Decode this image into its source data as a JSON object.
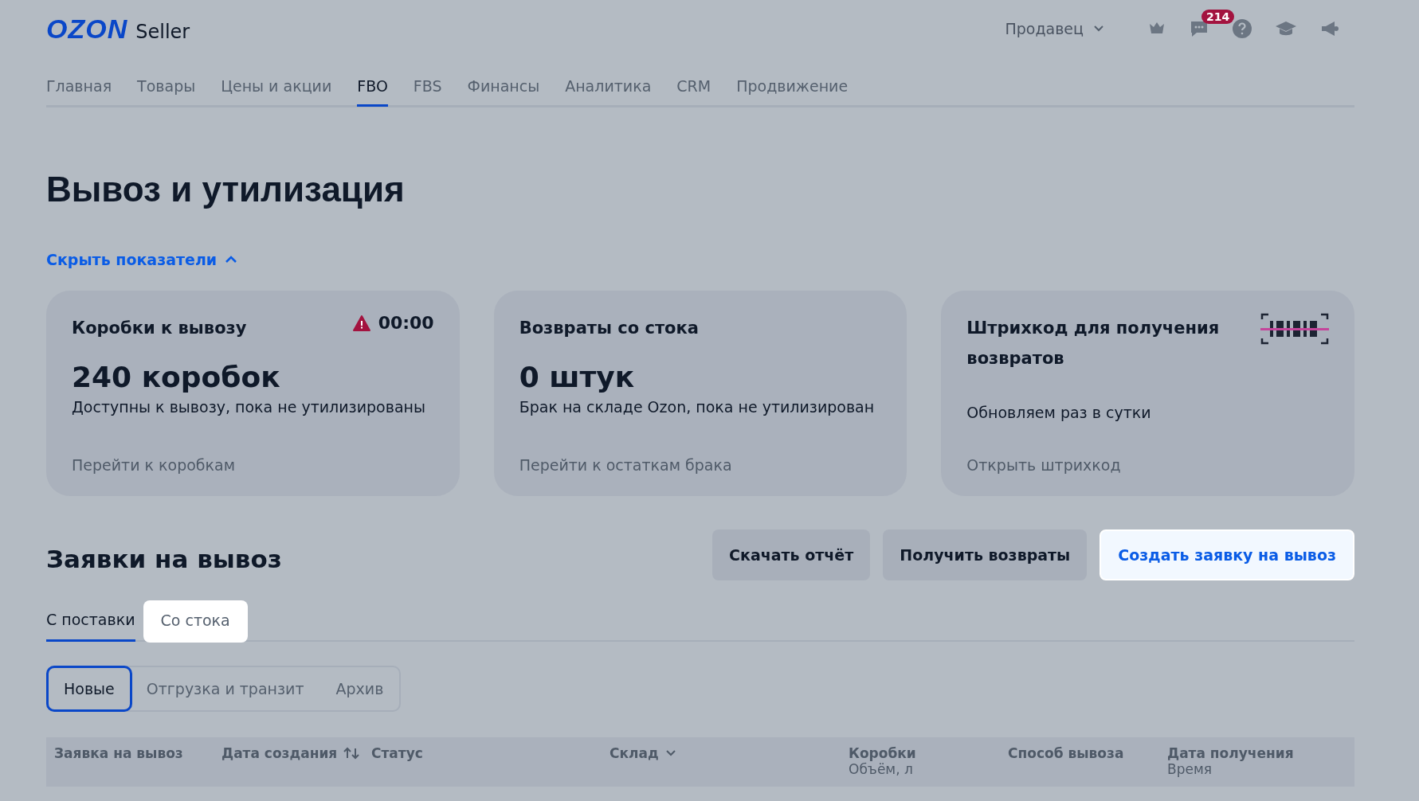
{
  "header": {
    "logo": "OZON",
    "logo_suffix": "Seller",
    "account": "Продавец",
    "chat_badge": "214"
  },
  "nav": [
    {
      "label": "Главная",
      "selected": false
    },
    {
      "label": "Товары",
      "selected": false
    },
    {
      "label": "Цены и акции",
      "selected": false
    },
    {
      "label": "FBO",
      "selected": true
    },
    {
      "label": "FBS",
      "selected": false
    },
    {
      "label": "Финансы",
      "selected": false
    },
    {
      "label": "Аналитика",
      "selected": false
    },
    {
      "label": "CRM",
      "selected": false
    },
    {
      "label": "Продвижение",
      "selected": false
    }
  ],
  "title": "Вывоз и утилизация",
  "toggle_metrics": "Скрыть показатели",
  "cards": [
    {
      "kind": "timer",
      "title": "Коробки к вывозу",
      "timer": "00:00",
      "value": "240 коробок",
      "description": "Доступны к вывозу, пока не утилизированы",
      "link": "Перейти к коробкам"
    },
    {
      "kind": "plain",
      "title": "Возвраты со стока",
      "value": "0 штук",
      "description": "Брак на складе Ozon, пока не утилизирован",
      "link": "Перейти к остаткам брака"
    },
    {
      "kind": "barcode",
      "title": "Штрихкод для получения возвратов",
      "description": "Обновляем раз в сутки",
      "link": "Открыть штрихкод"
    }
  ],
  "section_title": "Заявки на вывоз",
  "buttons": [
    {
      "label": "Скачать отчёт",
      "kind": "secondary"
    },
    {
      "label": "Получить возвраты",
      "kind": "secondary"
    },
    {
      "label": "Создать заявку на вывоз",
      "kind": "primary"
    }
  ],
  "tabs": [
    {
      "label": "С поставки",
      "selected": true
    },
    {
      "label": "Со стока",
      "selected": false
    }
  ],
  "filters": [
    {
      "label": "Новые",
      "selected": true
    },
    {
      "label": "Отгрузка и транзит",
      "selected": false
    },
    {
      "label": "Архив",
      "selected": false
    }
  ],
  "table": {
    "columns": [
      {
        "label": "Заявка на вывоз",
        "kind": "plain"
      },
      {
        "label": "Дата создания",
        "kind": "sort"
      },
      {
        "label": "Статус",
        "kind": "plain"
      },
      {
        "label": "Склад",
        "kind": "dropdown"
      },
      {
        "label": "Коробки",
        "sub": "Объём, л",
        "kind": "plain"
      },
      {
        "label": "Способ вывоза",
        "kind": "plain"
      },
      {
        "label": "Дата получения",
        "sub": "Время",
        "kind": "plain"
      }
    ]
  }
}
